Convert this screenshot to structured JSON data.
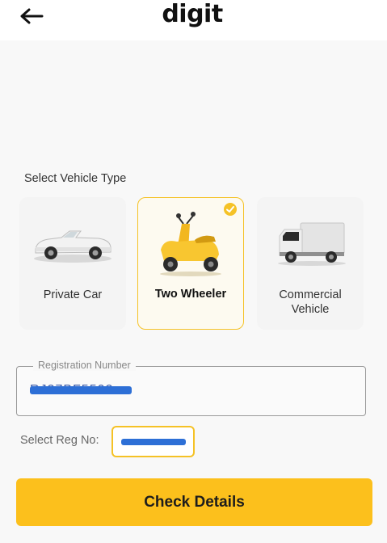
{
  "header": {
    "back_icon": "arrow-left-icon",
    "logo_text": "digit"
  },
  "vehicle_section": {
    "title": "Select Vehicle Type",
    "options": [
      {
        "label": "Private Car",
        "icon": "car-icon",
        "selected": false
      },
      {
        "label": "Two Wheeler",
        "icon": "scooter-icon",
        "selected": true
      },
      {
        "label_line1": "Commercial",
        "label_line2": "Vehicle",
        "icon": "truck-icon",
        "selected": false
      }
    ]
  },
  "registration": {
    "label": "Registration Number",
    "value": "RJ27BF5502"
  },
  "select_reg": {
    "label": "Select Reg No:"
  },
  "actions": {
    "check_details_label": "Check Details"
  },
  "colors": {
    "accent": "#fcc01c",
    "selected_border": "#f5c226",
    "redaction": "#2d6fd6"
  }
}
